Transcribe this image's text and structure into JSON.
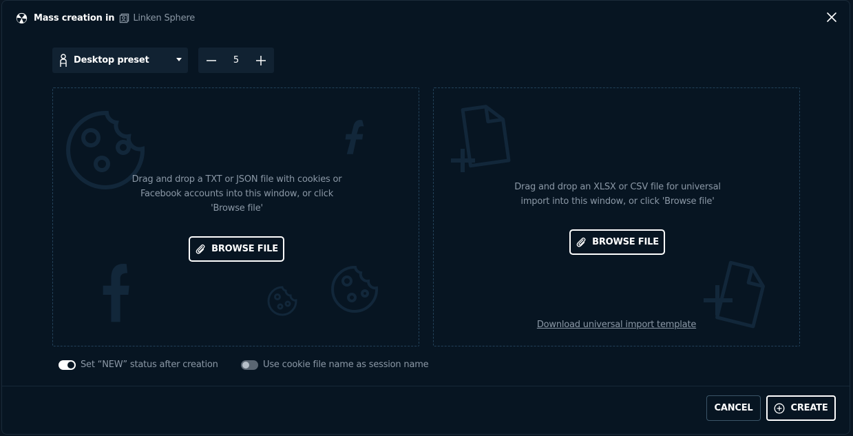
{
  "header": {
    "title": "Mass creation in",
    "provider": "Linken Sphere",
    "logo_icon": "linken-sphere-logo-icon",
    "close_icon": "close-icon"
  },
  "preset": {
    "label": "Desktop preset",
    "icon": "person-icon"
  },
  "stepper": {
    "value": "5"
  },
  "dropzone_left": {
    "text": "Drag and drop a TXT or JSON file with cookies or Facebook accounts into this window, or click 'Browse file'",
    "browse_label": "BROWSE FILE"
  },
  "dropzone_right": {
    "text": "Drag and drop an XLSX or CSV file for universal import into this window, or click 'Browse file'",
    "browse_label": "BROWSE FILE",
    "template_link": "Download universal import template"
  },
  "toggles": {
    "new_status": {
      "label": "Set “NEW” status after creation",
      "on": true
    },
    "cookie_name": {
      "label": "Use cookie file name as session name",
      "on": false
    }
  },
  "footer": {
    "cancel_label": "CANCEL",
    "create_label": "CREATE"
  },
  "colors": {
    "background": "#071522",
    "panel": "#112232",
    "dashed_border": "#23425a",
    "muted_text": "#8b98a6"
  }
}
